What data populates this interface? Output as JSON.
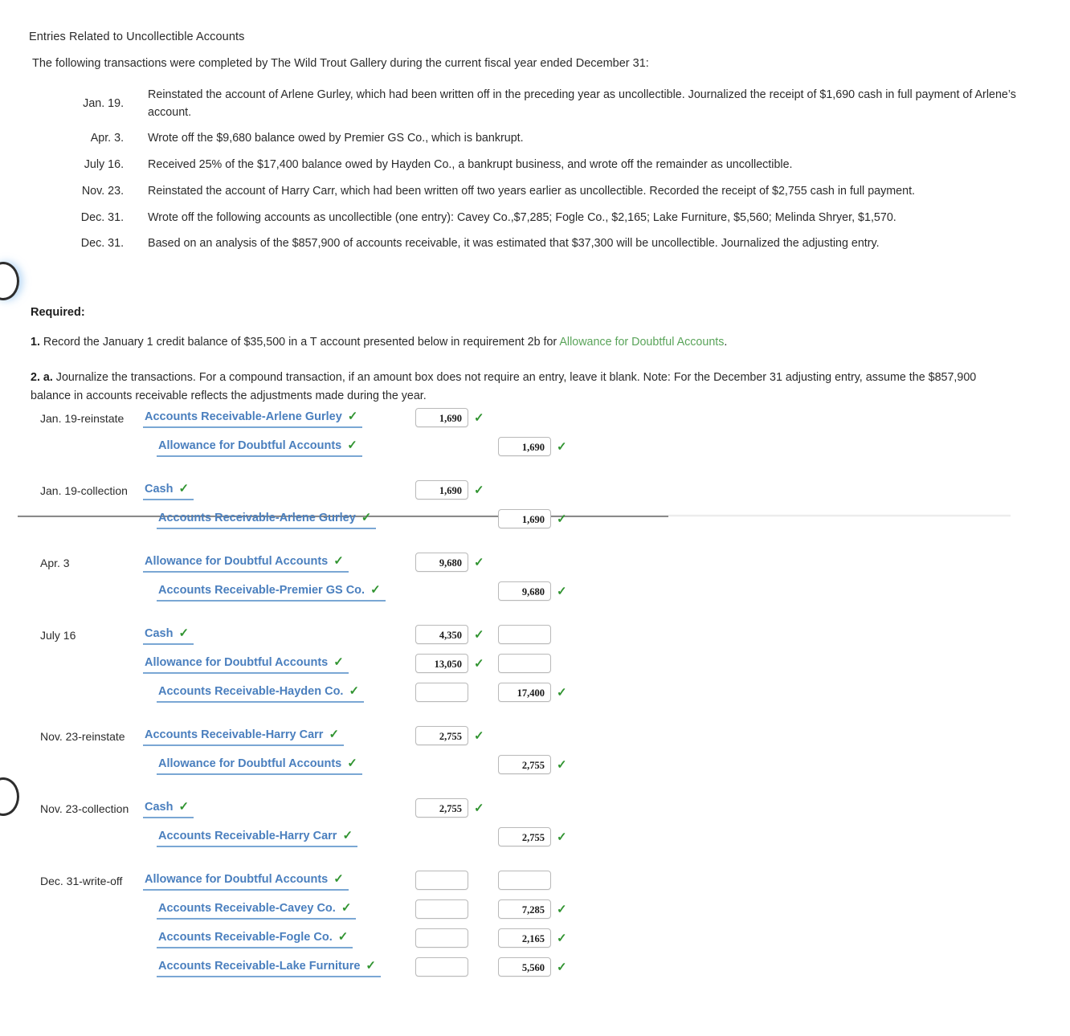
{
  "heading": "Entries Related to Uncollectible Accounts",
  "intro": "The following transactions were completed by The Wild Trout Gallery during the current fiscal year ended December 31:",
  "transactions": [
    {
      "date": "Jan. 19.",
      "desc": "Reinstated the account of Arlene Gurley, which had been written off in the preceding year as uncollectible. Journalized the receipt of $1,690 cash in full payment of Arlene’s account."
    },
    {
      "date": "Apr. 3.",
      "desc": "Wrote off the $9,680 balance owed by Premier GS Co., which is bankrupt."
    },
    {
      "date": "July 16.",
      "desc": "Received 25% of the $17,400 balance owed by Hayden Co., a bankrupt business, and wrote off the remainder as uncollectible."
    },
    {
      "date": "Nov. 23.",
      "desc": "Reinstated the account of Harry Carr, which had been written off two years earlier as uncollectible. Recorded the receipt of $2,755 cash in full payment."
    },
    {
      "date": "Dec. 31.",
      "desc": "Wrote off the following accounts as uncollectible (one entry): Cavey Co.,$7,285; Fogle Co., $2,165; Lake Furniture, $5,560; Melinda Shryer, $1,570."
    },
    {
      "date": "Dec. 31.",
      "desc": "Based on an analysis of the $857,900 of accounts receivable, it was estimated that $37,300 will be uncollectible. Journalized the adjusting entry."
    }
  ],
  "required_label": "Required:",
  "requirement_1": {
    "number": "1.",
    "text_before": " Record the January 1 credit balance of $35,500 in a T account presented below in requirement 2b for ",
    "account_link": "Allowance for Doubtful Accounts",
    "text_after": "."
  },
  "requirement_2": {
    "number": "2. a.",
    "text": " Journalize the transactions. For a compound transaction, if an amount box does not require an entry, leave it blank. Note: For the December 31 adjusting entry, assume the $857,900 balance in accounts receivable reflects the adjustments made during the year."
  },
  "colors": {
    "account_blue": "#4a7fbe",
    "underline_blue": "#7aa7d4",
    "check_green": "#319431",
    "link_green": "#5aa45a",
    "box_border": "#b9b9b9"
  },
  "icons": {
    "check": "✓"
  },
  "journal": {
    "entries": [
      {
        "date": "Jan. 19-reinstate",
        "lines": [
          {
            "account": "Accounts Receivable-Arlene Gurley",
            "indent": 0,
            "account_check": true,
            "debit": "1,690",
            "debit_box": true,
            "debit_check": true,
            "credit": "",
            "credit_box": false,
            "credit_check": false
          },
          {
            "account": "Allowance for Doubtful Accounts",
            "indent": 1,
            "account_check": true,
            "debit": "",
            "debit_box": false,
            "debit_check": false,
            "credit": "1,690",
            "credit_box": true,
            "credit_check": true
          }
        ]
      },
      {
        "date": "Jan. 19-collection",
        "lines": [
          {
            "account": "Cash",
            "indent": 0,
            "account_check": true,
            "debit": "1,690",
            "debit_box": true,
            "debit_check": true,
            "credit": "",
            "credit_box": false,
            "credit_check": false
          },
          {
            "account": "Accounts Receivable-Arlene Gurley",
            "indent": 1,
            "account_check": true,
            "debit": "",
            "debit_box": false,
            "debit_check": false,
            "credit": "1,690",
            "credit_box": true,
            "credit_check": true
          }
        ]
      },
      {
        "date": "Apr. 3",
        "lines": [
          {
            "account": "Allowance for Doubtful Accounts",
            "indent": 0,
            "account_check": true,
            "debit": "9,680",
            "debit_box": true,
            "debit_check": true,
            "credit": "",
            "credit_box": false,
            "credit_check": false
          },
          {
            "account": "Accounts Receivable-Premier GS Co.",
            "indent": 1,
            "account_check": true,
            "debit": "",
            "debit_box": false,
            "debit_check": false,
            "credit": "9,680",
            "credit_box": true,
            "credit_check": true
          }
        ]
      },
      {
        "date": "July 16",
        "lines": [
          {
            "account": "Cash",
            "indent": 0,
            "account_check": true,
            "debit": "4,350",
            "debit_box": true,
            "debit_check": true,
            "credit": "",
            "credit_box": true,
            "credit_check": false
          },
          {
            "account": "Allowance for Doubtful Accounts",
            "indent": 0,
            "account_check": true,
            "debit": "13,050",
            "debit_box": true,
            "debit_check": true,
            "credit": "",
            "credit_box": true,
            "credit_check": false
          },
          {
            "account": "Accounts Receivable-Hayden Co.",
            "indent": 1,
            "account_check": true,
            "debit": "",
            "debit_box": true,
            "debit_check": false,
            "credit": "17,400",
            "credit_box": true,
            "credit_check": true
          }
        ]
      },
      {
        "date": "Nov. 23-reinstate",
        "lines": [
          {
            "account": "Accounts Receivable-Harry Carr",
            "indent": 0,
            "account_check": true,
            "debit": "2,755",
            "debit_box": true,
            "debit_check": true,
            "credit": "",
            "credit_box": false,
            "credit_check": false
          },
          {
            "account": "Allowance for Doubtful Accounts",
            "indent": 1,
            "account_check": true,
            "debit": "",
            "debit_box": false,
            "debit_check": false,
            "credit": "2,755",
            "credit_box": true,
            "credit_check": true
          }
        ]
      },
      {
        "date": "Nov. 23-collection",
        "lines": [
          {
            "account": "Cash",
            "indent": 0,
            "account_check": true,
            "debit": "2,755",
            "debit_box": true,
            "debit_check": true,
            "credit": "",
            "credit_box": false,
            "credit_check": false
          },
          {
            "account": "Accounts Receivable-Harry Carr",
            "indent": 1,
            "account_check": true,
            "debit": "",
            "debit_box": false,
            "debit_check": false,
            "credit": "2,755",
            "credit_box": true,
            "credit_check": true
          }
        ]
      },
      {
        "date": "Dec. 31-write-off",
        "lines": [
          {
            "account": "Allowance for Doubtful Accounts",
            "indent": 0,
            "account_check": true,
            "debit": "",
            "debit_box": true,
            "debit_check": false,
            "credit": "",
            "credit_box": true,
            "credit_check": false
          },
          {
            "account": "Accounts Receivable-Cavey Co.",
            "indent": 1,
            "account_check": true,
            "debit": "",
            "debit_box": true,
            "debit_check": false,
            "credit": "7,285",
            "credit_box": true,
            "credit_check": true
          },
          {
            "account": "Accounts Receivable-Fogle Co.",
            "indent": 1,
            "account_check": true,
            "debit": "",
            "debit_box": true,
            "debit_check": false,
            "credit": "2,165",
            "credit_box": true,
            "credit_check": true
          },
          {
            "account": "Accounts Receivable-Lake Furniture",
            "indent": 1,
            "account_check": true,
            "debit": "",
            "debit_box": true,
            "debit_check": false,
            "credit": "5,560",
            "credit_box": true,
            "credit_check": true
          }
        ]
      }
    ]
  }
}
